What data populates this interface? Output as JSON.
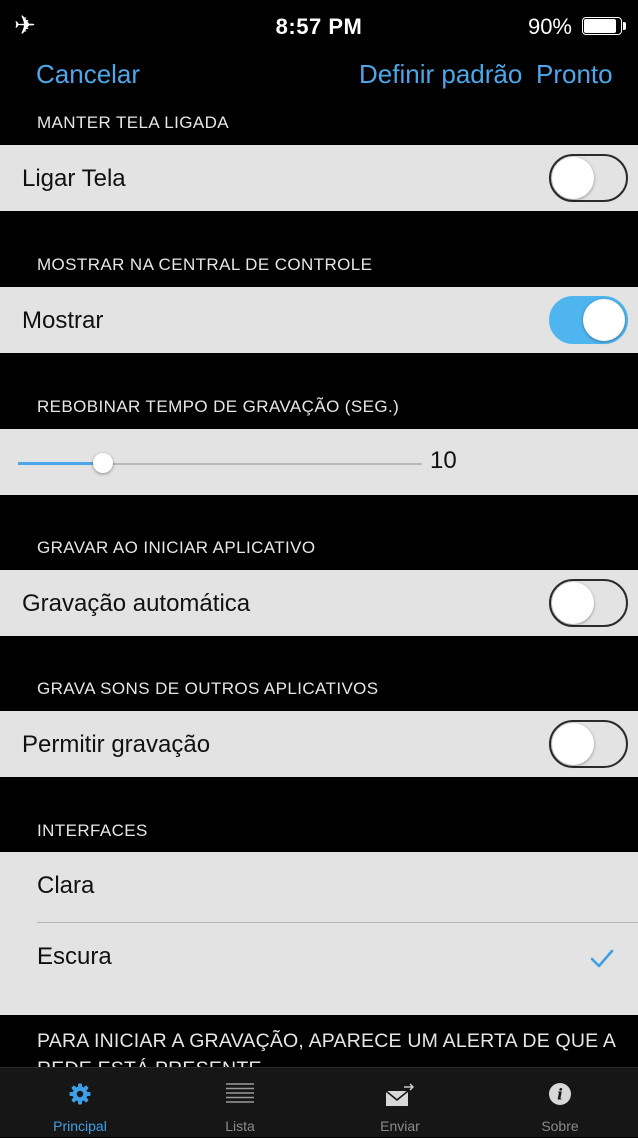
{
  "status_bar": {
    "time": "8:57 PM",
    "battery_percent": "90%",
    "battery_level": 0.9,
    "airplane_icon": "airplane-icon"
  },
  "nav": {
    "cancel": "Cancelar",
    "define_default": "Definir padrão",
    "done": "Pronto"
  },
  "sections": {
    "keep_screen": {
      "header": "MANTER TELA LIGADA",
      "label": "Ligar Tela",
      "on": false
    },
    "control_center": {
      "header": "MOSTRAR NA CENTRAL DE CONTROLE",
      "label": "Mostrar",
      "on": true
    },
    "rewind": {
      "header": "REBOBINAR TEMPO DE GRAVAÇÃO (SEG.)",
      "value": "10"
    },
    "start_record": {
      "header": "GRAVAR AO INICIAR APLICATIVO",
      "label": "Gravação automática",
      "on": false
    },
    "other_apps": {
      "header": "GRAVA SONS DE OUTROS APLICATIVOS",
      "label": "Permitir gravação",
      "on": false
    },
    "interfaces": {
      "header": "INTERFACES",
      "options": [
        "Clara",
        "Escura"
      ],
      "selected": "Escura"
    }
  },
  "footer_note": "PARA INICIAR A GRAVAÇÃO, APARECE UM ALERTA DE QUE A REDE ESTÁ PRESENTE",
  "tab_bar": {
    "tabs": [
      {
        "label": "Principal",
        "icon": "gear-icon",
        "active": true
      },
      {
        "label": "Lista",
        "icon": "list-icon",
        "active": false
      },
      {
        "label": "Enviar",
        "icon": "send-envelope-icon",
        "active": false
      },
      {
        "label": "Sobre",
        "icon": "info-icon",
        "active": false
      }
    ]
  },
  "colors": {
    "accent": "#4ba7ea",
    "toggle_on": "#4fb5ef",
    "row_background": "#e3e3e3",
    "page_background": "#000000"
  }
}
